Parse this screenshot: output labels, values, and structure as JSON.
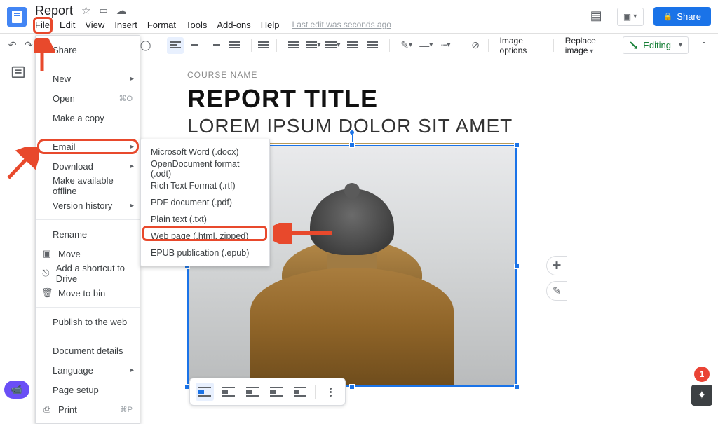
{
  "header": {
    "doc_title": "Report",
    "menus": [
      "File",
      "Edit",
      "View",
      "Insert",
      "Format",
      "Tools",
      "Add-ons",
      "Help"
    ],
    "last_edit": "Last edit was seconds ago",
    "share_label": "Share"
  },
  "toolbar": {
    "image_options": "Image options",
    "replace_image": "Replace image",
    "editing_label": "Editing"
  },
  "file_menu": {
    "share": "Share",
    "new": "New",
    "open": "Open",
    "open_shortcut": "⌘O",
    "make_copy": "Make a copy",
    "email": "Email",
    "download": "Download",
    "available_offline": "Make available offline",
    "version_history": "Version history",
    "rename": "Rename",
    "move": "Move",
    "add_shortcut": "Add a shortcut to Drive",
    "move_to_bin": "Move to bin",
    "publish": "Publish to the web",
    "doc_details": "Document details",
    "language": "Language",
    "page_setup": "Page setup",
    "print": "Print",
    "print_shortcut": "⌘P"
  },
  "download_menu": {
    "docx": "Microsoft Word (.docx)",
    "odt": "OpenDocument format (.odt)",
    "rtf": "Rich Text Format (.rtf)",
    "pdf": "PDF document (.pdf)",
    "txt": "Plain text (.txt)",
    "html": "Web page (.html, zipped)",
    "epub": "EPUB publication (.epub)"
  },
  "doc": {
    "course_name": "COURSE NAME",
    "report_title": "REPORT TITLE",
    "subtitle": "LOREM IPSUM DOLOR SIT AMET"
  },
  "badges": {
    "explore_count": "1"
  }
}
